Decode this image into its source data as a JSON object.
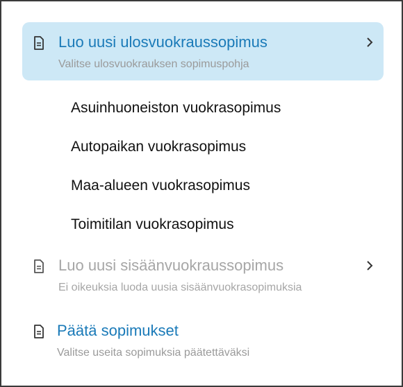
{
  "menu": {
    "create_outbound": {
      "title": "Luo uusi ulosvuokraussopimus",
      "subtitle": "Valitse ulosvuokrauksen sopimuspohja",
      "icon": "document-icon",
      "chevron": "chevron-right-icon",
      "active": true
    },
    "templates": [
      {
        "label": "Asuinhuoneiston vuokrasopimus"
      },
      {
        "label": "Autopaikan vuokrasopimus"
      },
      {
        "label": "Maa-alueen vuokrasopimus"
      },
      {
        "label": "Toimitilan vuokrasopimus"
      }
    ],
    "create_inbound": {
      "title": "Luo uusi sisäänvuokraussopimus",
      "subtitle": "Ei oikeuksia luoda uusia sisäänvuokrasopimuksia",
      "icon": "document-icon",
      "chevron": "chevron-right-icon",
      "disabled": true
    },
    "terminate": {
      "title": "Päätä sopimukset",
      "subtitle": "Valitse useita sopimuksia päätettäväksi",
      "icon": "document-icon"
    }
  },
  "colors": {
    "accent": "#1a7ab8",
    "active_bg": "#cde8f6",
    "muted": "#9a9a9a",
    "disabled": "#a6a6a6",
    "text": "#111111"
  }
}
